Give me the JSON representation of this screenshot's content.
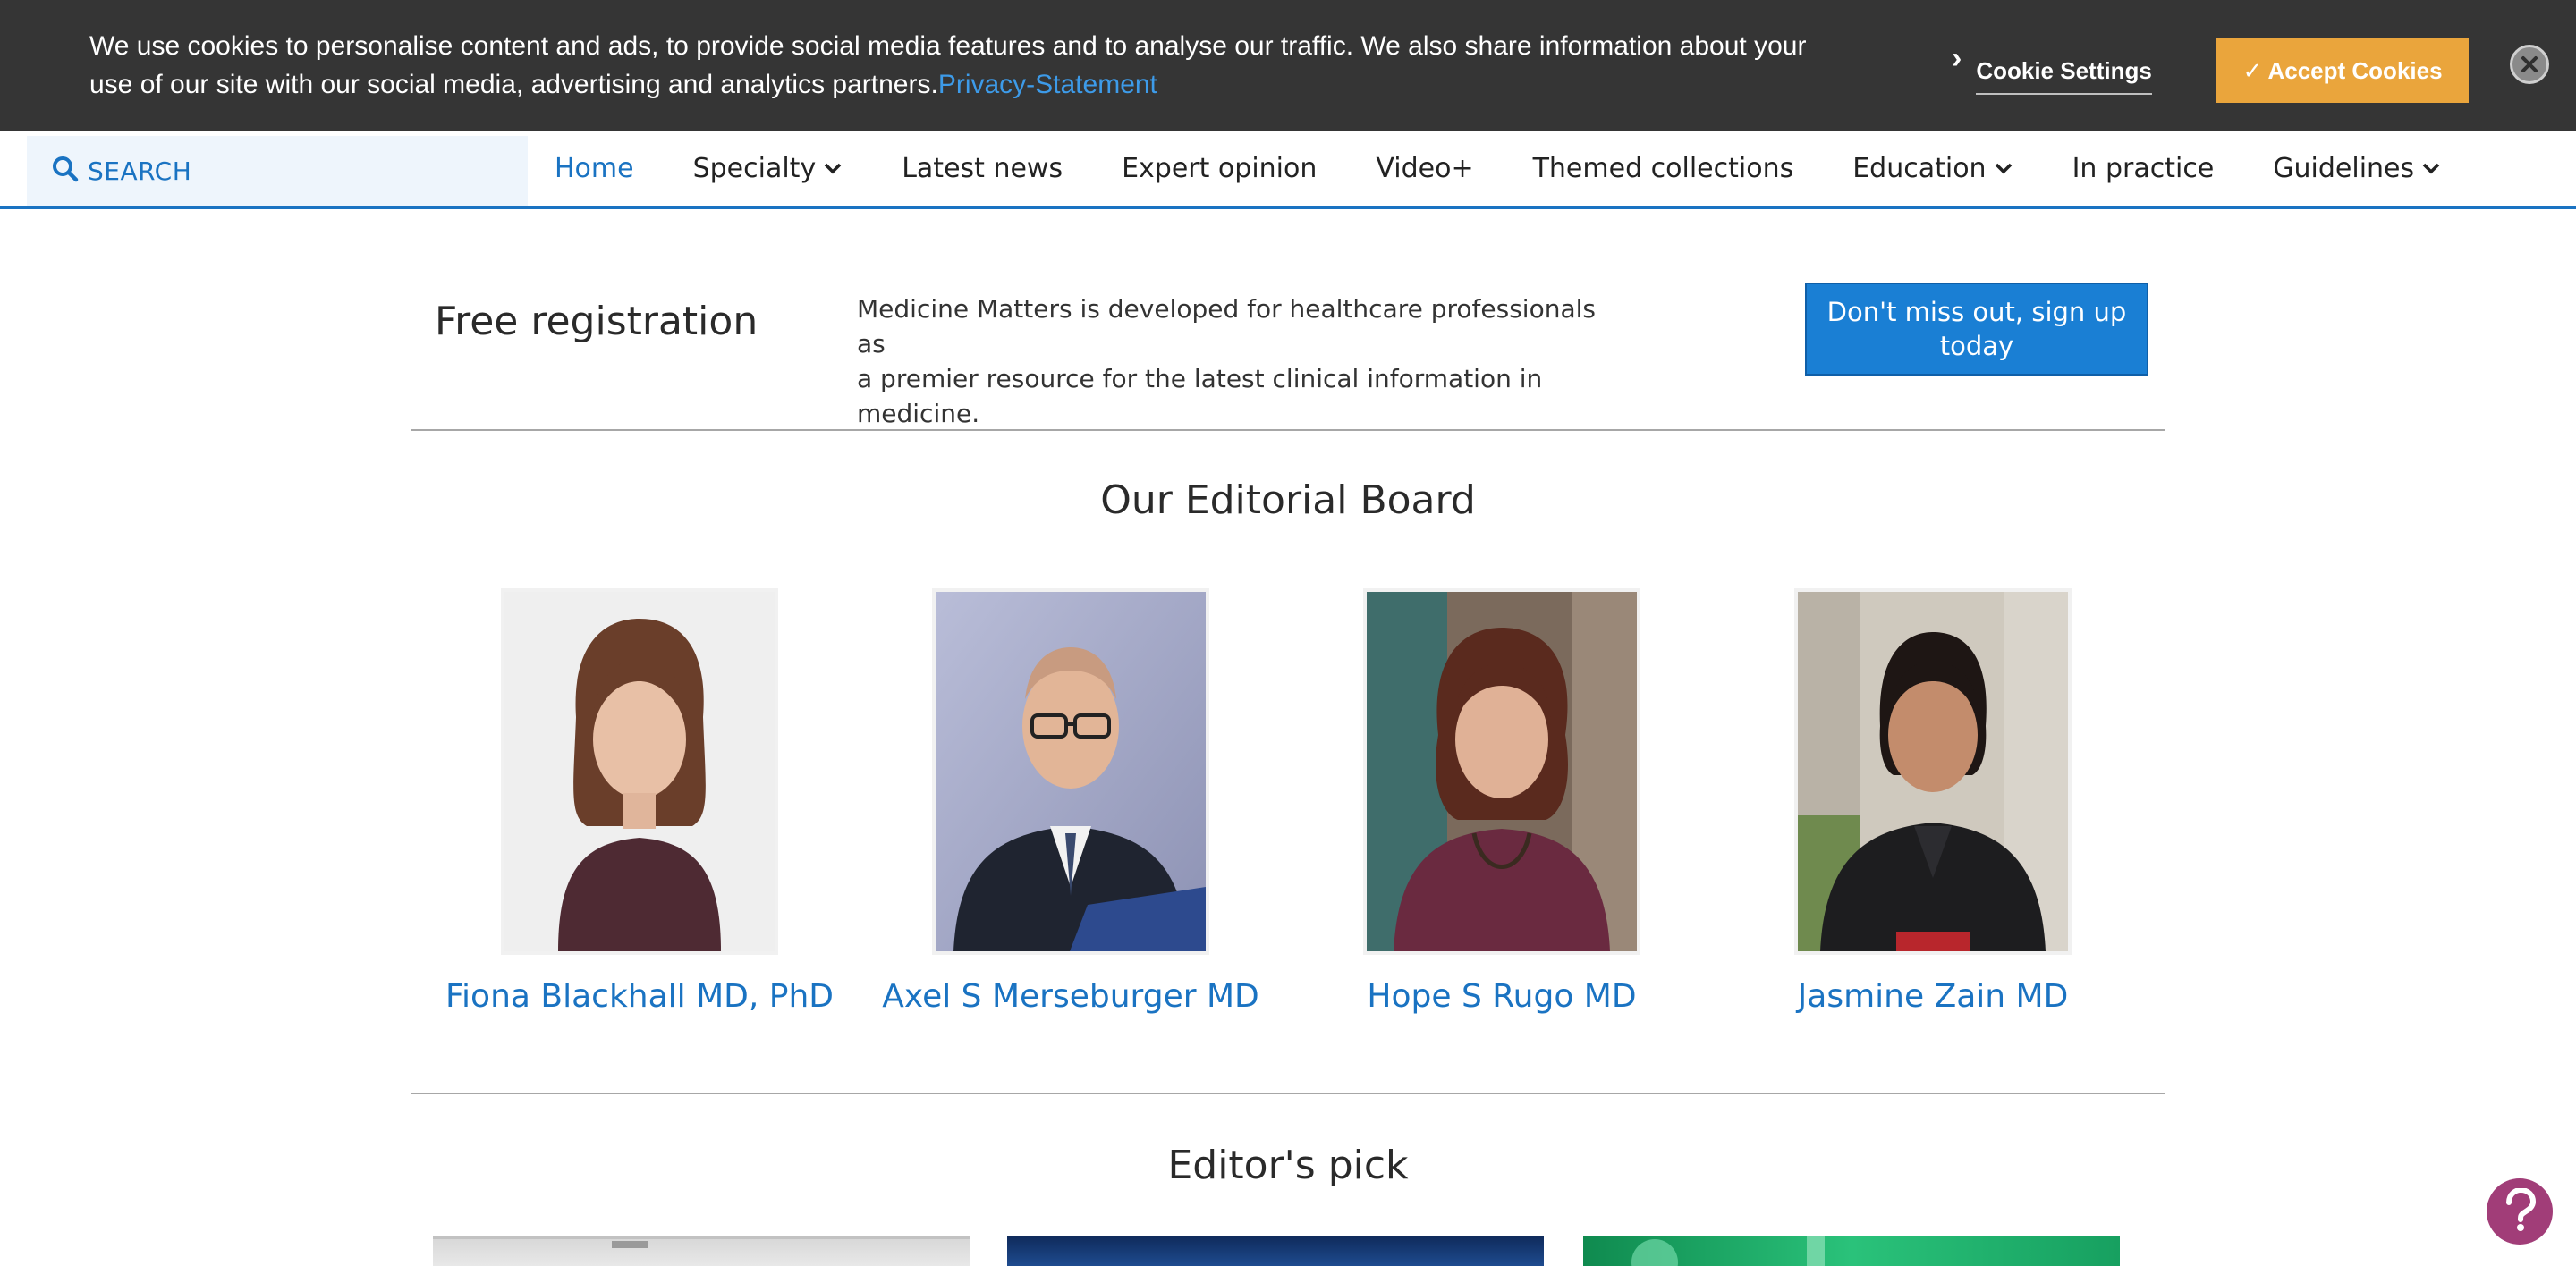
{
  "cookie_banner": {
    "text": "We use cookies to personalise content and ads, to provide social media features and to analyse our traffic. We also share information about your use of our site with our social media, advertising and analytics partners.",
    "privacy_link": "Privacy-Statement",
    "settings_label": "Cookie Settings",
    "accept_label": "✓ Accept Cookies",
    "accept_color": "#eaa53c"
  },
  "nav": {
    "search_label": "SEARCH",
    "items": [
      {
        "label": "Home",
        "active": true
      },
      {
        "label": "Specialty",
        "dropdown": true
      },
      {
        "label": "Latest news"
      },
      {
        "label": "Expert opinion"
      },
      {
        "label": "Video+"
      },
      {
        "label": "Themed collections"
      },
      {
        "label": "Education",
        "dropdown": true
      },
      {
        "label": "In practice"
      },
      {
        "label": "Guidelines",
        "dropdown": true
      }
    ],
    "accent_color": "#1a73c2"
  },
  "registration": {
    "title": "Free registration",
    "description_line1": "Medicine Matters is developed for healthcare professionals as",
    "description_line2": "a premier resource for the latest clinical information in medicine.",
    "button_label": "Don't miss out, sign up today"
  },
  "editorial_board": {
    "title": "Our Editorial Board",
    "members": [
      {
        "name": "Fiona Blackhall MD, PhD"
      },
      {
        "name": "Axel S Merseburger MD"
      },
      {
        "name": "Hope S Rugo MD"
      },
      {
        "name": "Jasmine Zain MD"
      }
    ]
  },
  "editors_pick": {
    "title": "Editor's pick"
  },
  "icons": {
    "search": "search-icon",
    "close": "close-icon",
    "help": "question-mark-icon",
    "caret": "chevron-down-icon",
    "cookie_chevron": "chevron-right-icon"
  }
}
